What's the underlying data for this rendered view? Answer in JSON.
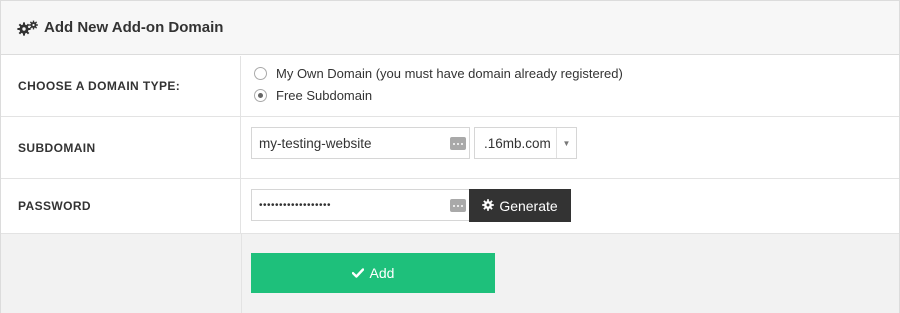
{
  "header": {
    "title": "Add New Add-on Domain",
    "icon": "gears-icon"
  },
  "domain_type": {
    "label": "CHOOSE A DOMAIN TYPE:",
    "options": [
      {
        "label": "My Own Domain (you must have domain already registered)",
        "checked": false
      },
      {
        "label": "Free Subdomain",
        "checked": true
      }
    ]
  },
  "subdomain": {
    "label": "SUBDOMAIN",
    "value": "my-testing-website",
    "suffix_selected": ".16mb.com"
  },
  "password": {
    "label": "PASSWORD",
    "masked_value": "••••••••••••••••••",
    "generate_label": "Generate"
  },
  "footer": {
    "add_label": "Add"
  },
  "colors": {
    "accent_green": "#1ec07b",
    "dark_button": "#333333"
  }
}
